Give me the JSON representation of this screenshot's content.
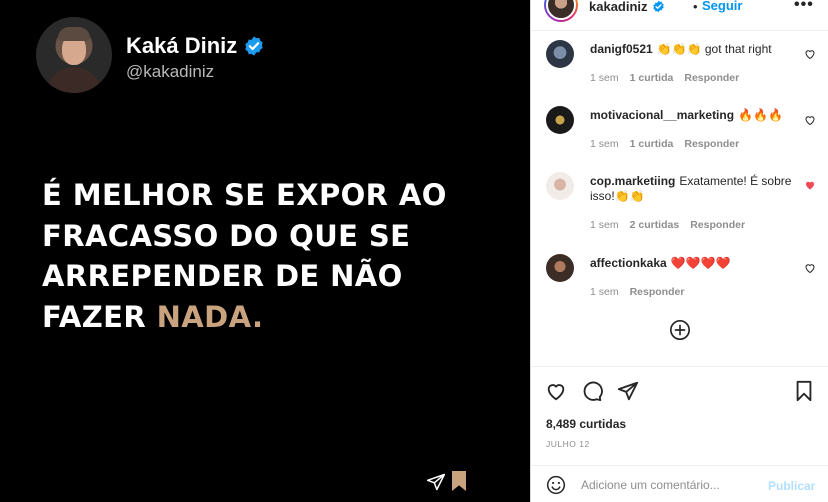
{
  "tweet": {
    "name": "Kaká Diniz",
    "handle": "@kakadiniz",
    "quote_line1": "É MELHOR SE EXPOR AO",
    "quote_line2": "FRACASSO DO QUE SE",
    "quote_line3": "ARREPENDER DE NÃO",
    "quote_line4_a": "FAZER",
    "quote_line4_b": "NADA.",
    "accent_color": "#c9a27e"
  },
  "header": {
    "username": "kakadiniz",
    "dot": "•",
    "follow_label": "Seguir",
    "more_label": "•••"
  },
  "comments": [
    {
      "user": "danigf0521",
      "text": "👏👏👏 got that right",
      "time": "1 sem",
      "likes": "1 curtida",
      "reply": "Responder",
      "liked": false
    },
    {
      "user": "motivacional__marketing",
      "text": "🔥🔥🔥",
      "time": "1 sem",
      "likes": "1 curtida",
      "reply": "Responder",
      "liked": false
    },
    {
      "user": "cop.marketiing",
      "text": "Exatamente! É sobre isso!👏👏",
      "time": "1 sem",
      "likes": "2 curtidas",
      "reply": "Responder",
      "liked": true
    },
    {
      "user": "affectionkaka",
      "text": "❤️❤️❤️❤️",
      "time": "1 sem",
      "likes": "",
      "reply": "Responder",
      "liked": false
    }
  ],
  "stats": {
    "likes": "8,489 curtidas",
    "date": "JULHO 12"
  },
  "composer": {
    "placeholder": "Adicione um comentário...",
    "publish_label": "Publicar"
  },
  "colors": {
    "link_blue": "#0095f6",
    "publish_disabled": "#b2dffc",
    "heart_red": "#ed4956"
  }
}
